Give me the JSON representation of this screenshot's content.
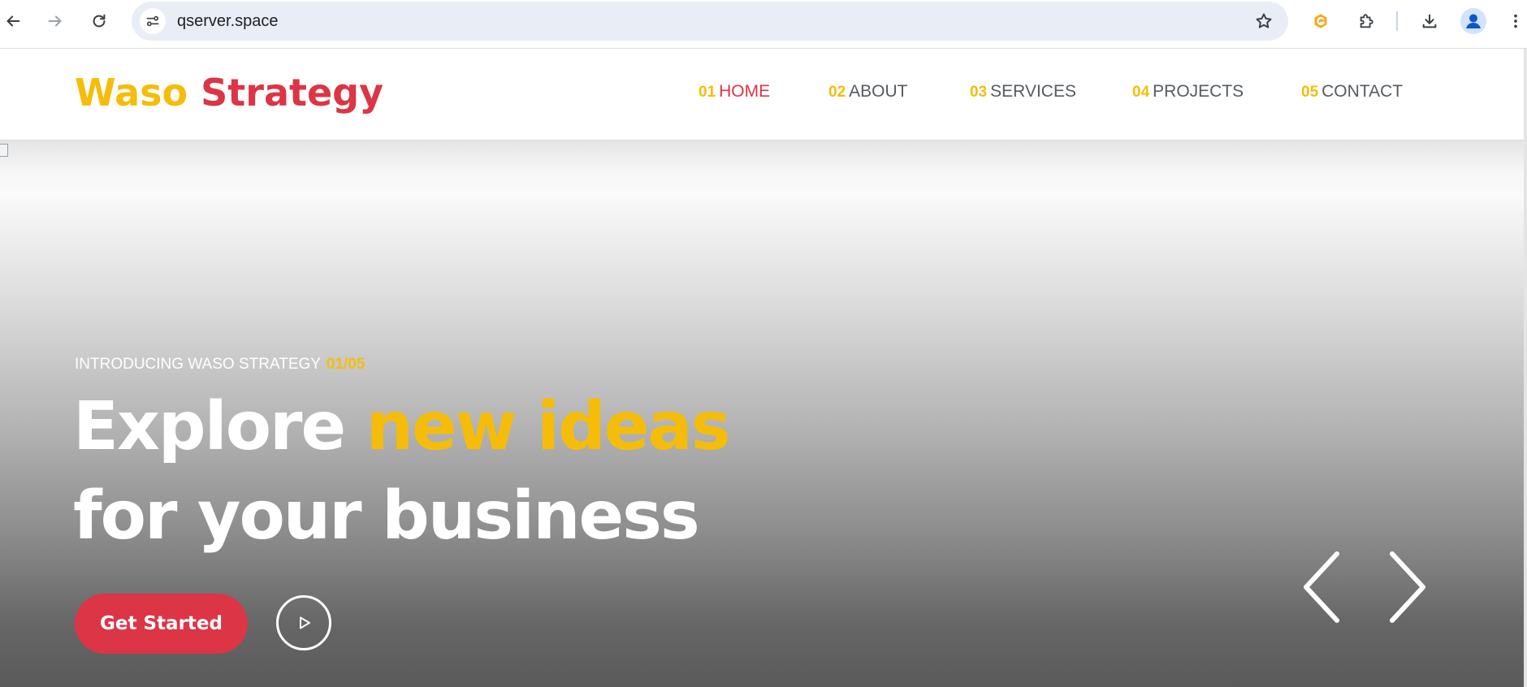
{
  "browser": {
    "url": "qserver.space",
    "icons": [
      "back-icon",
      "forward-icon",
      "reload-icon",
      "site-info-icon",
      "star-icon",
      "grammarly-extension-icon",
      "extensions-icon",
      "download-icon",
      "profile-icon",
      "menu-icon"
    ]
  },
  "site": {
    "logo_word1": "Waso",
    "logo_word2": "Strategy",
    "nav": [
      {
        "num": "01",
        "label": "HOME",
        "active": true
      },
      {
        "num": "02",
        "label": "ABOUT",
        "active": false
      },
      {
        "num": "03",
        "label": "SERVICES",
        "active": false
      },
      {
        "num": "04",
        "label": "PROJECTS",
        "active": false
      },
      {
        "num": "05",
        "label": "CONTACT",
        "active": false
      }
    ]
  },
  "hero": {
    "eyebrow": "INTRODUCING WASO STRATEGY",
    "slide_counter": "01/05",
    "headline_part1": "Explore",
    "headline_accent": "new ideas",
    "headline_line2": "for your business",
    "cta_label": "Get Started"
  },
  "colors": {
    "accent_yellow": "#f5bd0a",
    "accent_red": "#dc3545",
    "omnibox_bg": "#e9edf6"
  }
}
